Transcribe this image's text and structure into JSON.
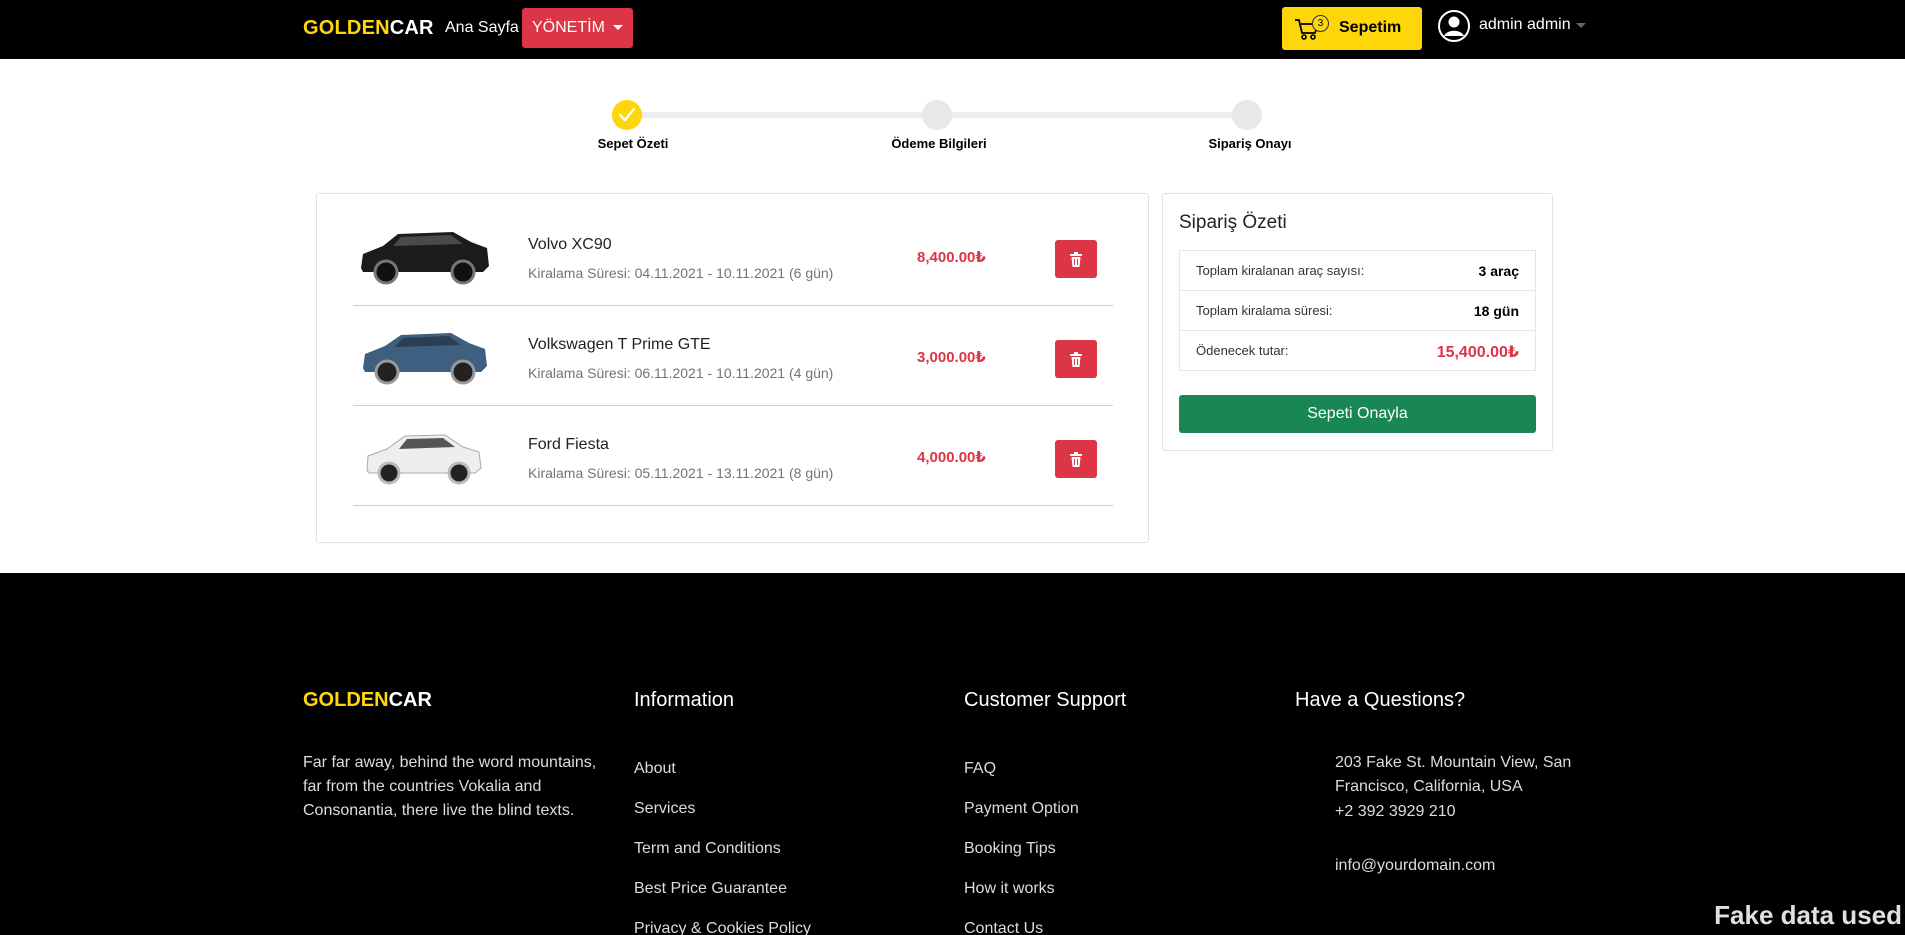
{
  "navbar": {
    "brand_gold": "GOLDEN",
    "brand_white": "CAR",
    "home_label": "Ana Sayfa",
    "admin_label": "YÖNETİM",
    "cart_label": "Sepetim",
    "cart_count": "3",
    "user_name": "admin admin"
  },
  "stepper": {
    "steps": [
      {
        "label": "Sepet Özeti",
        "state": "done"
      },
      {
        "label": "Ödeme Bilgileri",
        "state": "pending"
      },
      {
        "label": "Sipariş Onayı",
        "state": "pending"
      }
    ]
  },
  "cart": {
    "items": [
      {
        "name": "Volvo XC90",
        "period": "Kiralama Süresi: 04.11.2021 - 10.11.2021 (6 gün)",
        "price": "8,400.00₺",
        "color": "#1c1c1c"
      },
      {
        "name": "Volkswagen T Prime GTE",
        "period": "Kiralama Süresi: 06.11.2021 - 10.11.2021 (4 gün)",
        "price": "3,000.00₺",
        "color": "#3e5f80"
      },
      {
        "name": "Ford Fiesta",
        "period": "Kiralama Süresi: 05.11.2021 - 13.11.2021 (8 gün)",
        "price": "4,000.00₺",
        "color": "#eeeeee"
      }
    ]
  },
  "summary": {
    "title": "Sipariş Özeti",
    "rows": [
      {
        "label": "Toplam kiralanan araç sayısı:",
        "value": "3 araç"
      },
      {
        "label": "Toplam kiralama süresi:",
        "value": "18 gün"
      },
      {
        "label": "Ödenecek tutar:",
        "value": "15,400.00₺"
      }
    ],
    "confirm_label": "Sepeti Onayla"
  },
  "footer": {
    "brand_gold": "GOLDEN",
    "brand_white": "CAR",
    "about": "Far far away, behind the word mountains, far from the countries Vokalia and Consonantia, there live the blind texts.",
    "information": {
      "heading": "Information",
      "links": [
        "About",
        "Services",
        "Term and Conditions",
        "Best Price Guarantee",
        "Privacy & Cookies Policy"
      ]
    },
    "support": {
      "heading": "Customer Support",
      "links": [
        "FAQ",
        "Payment Option",
        "Booking Tips",
        "How it works",
        "Contact Us"
      ]
    },
    "contact": {
      "heading": "Have a Questions?",
      "address": "203 Fake St. Mountain View, San Francisco, California, USA",
      "phone": "+2 392 3929 210",
      "email": "info@yourdomain.com"
    }
  },
  "watermark": "Fake data used",
  "colors": {
    "accent": "#ffd60a",
    "danger": "#dc3545",
    "success": "#198754"
  }
}
